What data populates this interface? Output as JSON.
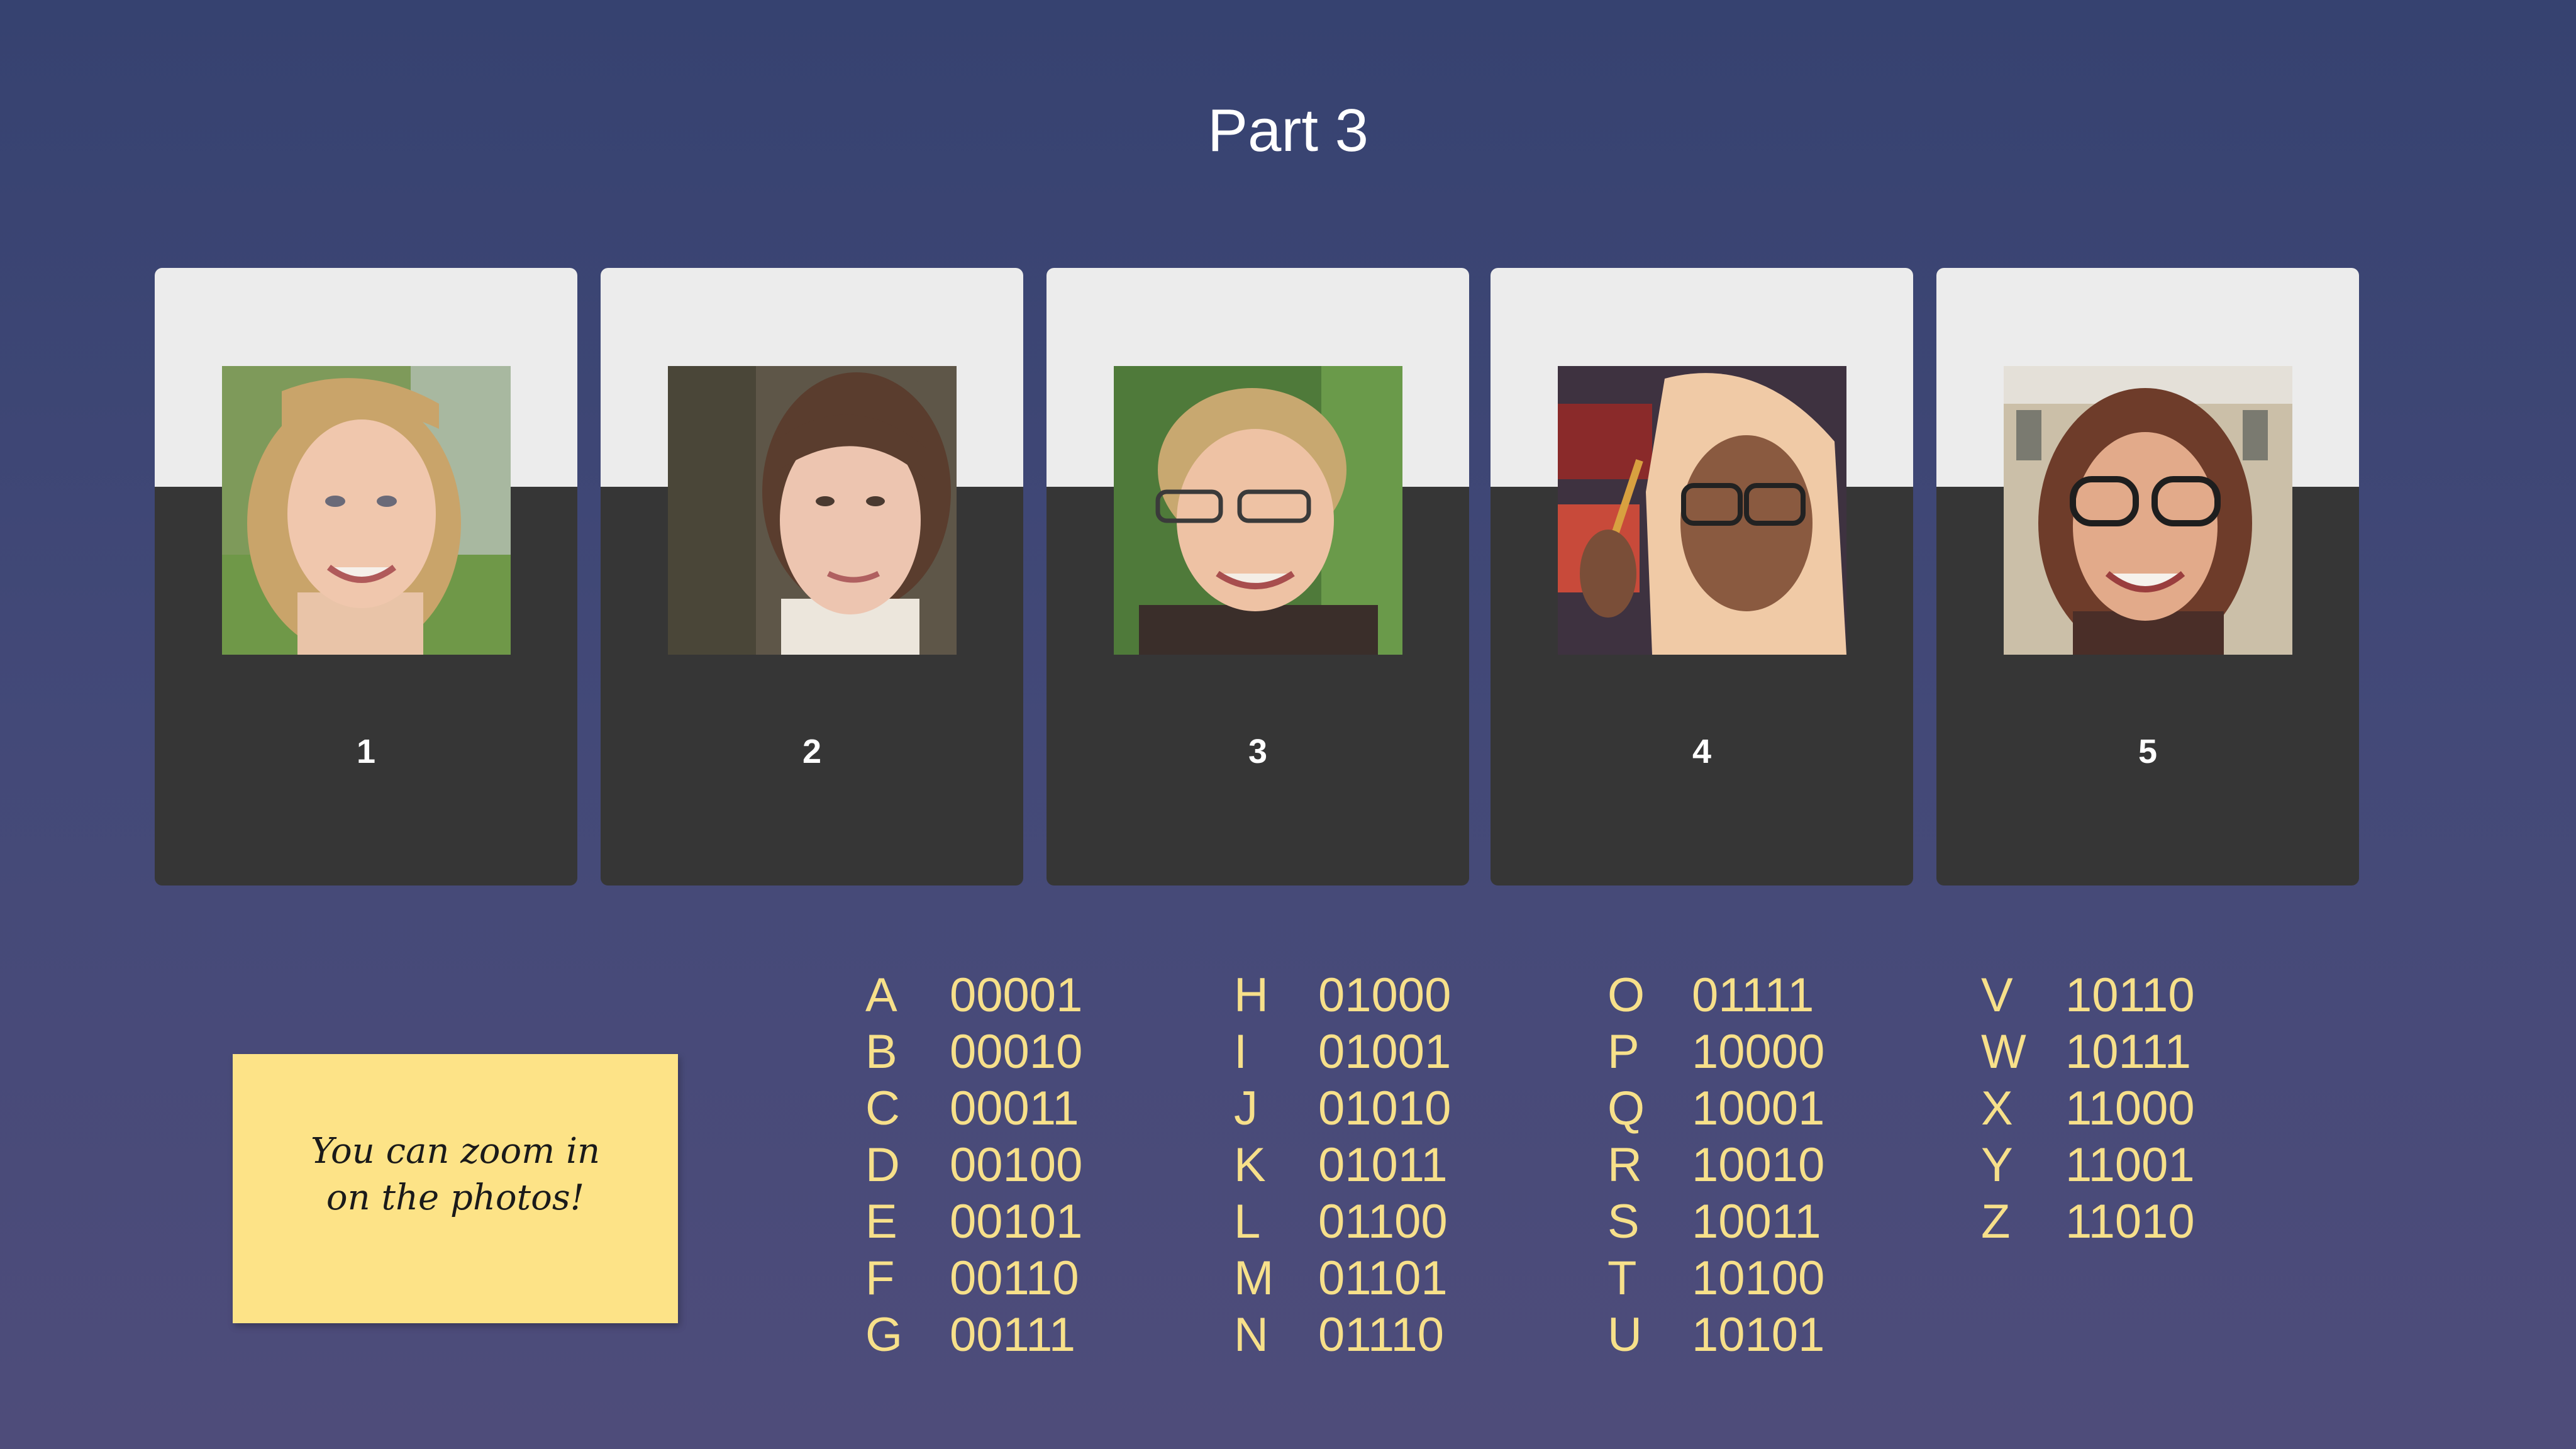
{
  "title": "Part 3",
  "cards": [
    {
      "number": "1",
      "photo": "portrait-young-woman-blonde-smiling"
    },
    {
      "number": "2",
      "photo": "portrait-young-woman-dark-hair"
    },
    {
      "number": "3",
      "photo": "portrait-woman-glasses-short-hair"
    },
    {
      "number": "4",
      "photo": "portrait-woman-hijab-glasses"
    },
    {
      "number": "5",
      "photo": "portrait-woman-glasses-smiling"
    }
  ],
  "note": {
    "text": "You can zoom in\non the photos!"
  },
  "code_table": [
    [
      {
        "letter": "A",
        "code": "00001"
      },
      {
        "letter": "B",
        "code": "00010"
      },
      {
        "letter": "C",
        "code": "00011"
      },
      {
        "letter": "D",
        "code": "00100"
      },
      {
        "letter": "E",
        "code": "00101"
      },
      {
        "letter": "F",
        "code": "00110"
      },
      {
        "letter": "G",
        "code": "00111"
      }
    ],
    [
      {
        "letter": "H",
        "code": "01000"
      },
      {
        "letter": "I",
        "code": "01001"
      },
      {
        "letter": "J",
        "code": "01010"
      },
      {
        "letter": "K",
        "code": "01011"
      },
      {
        "letter": "L",
        "code": "01100"
      },
      {
        "letter": "M",
        "code": "01101"
      },
      {
        "letter": "N",
        "code": "01110"
      }
    ],
    [
      {
        "letter": "O",
        "code": "01111"
      },
      {
        "letter": "P",
        "code": "10000"
      },
      {
        "letter": "Q",
        "code": "10001"
      },
      {
        "letter": "R",
        "code": "10010"
      },
      {
        "letter": "S",
        "code": "10011"
      },
      {
        "letter": "T",
        "code": "10100"
      },
      {
        "letter": "U",
        "code": "10101"
      }
    ],
    [
      {
        "letter": "V",
        "code": "10110"
      },
      {
        "letter": "W",
        "code": "10111"
      },
      {
        "letter": "X",
        "code": "11000"
      },
      {
        "letter": "Y",
        "code": "11001"
      },
      {
        "letter": "Z",
        "code": "11010"
      }
    ]
  ],
  "colors": {
    "background_top": "#364270",
    "background_bottom": "#4e4c7a",
    "card_dark": "#363636",
    "card_light": "#ececec",
    "code_text": "#f7e08a",
    "note_background": "#fde387"
  }
}
